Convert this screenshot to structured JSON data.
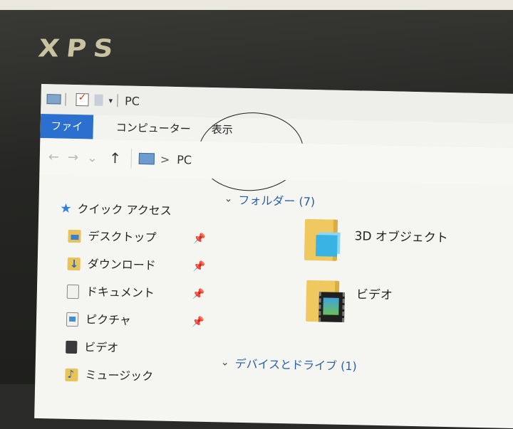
{
  "bezel": {
    "logo_text": "XPS"
  },
  "quick_access_toolbar": {
    "title": "PC",
    "dropdown_glyph": "▾"
  },
  "ribbon": {
    "tabs": [
      {
        "label": "ファイル",
        "active": true
      },
      {
        "label": "コンピューター",
        "active": false
      },
      {
        "label": "表示",
        "active": false
      }
    ],
    "accent_color": "#2b6fcf"
  },
  "address_bar": {
    "back_glyph": "←",
    "forward_glyph": "→",
    "recent_glyph": "⌄",
    "up_glyph": "↑",
    "separator_glyph": ">",
    "location": "PC"
  },
  "nav_pane": {
    "quick_access": {
      "label": "クイック アクセス",
      "icon": "star-icon"
    },
    "items": [
      {
        "label": "デスクトップ",
        "icon": "desktop-folder-icon",
        "pinned": true
      },
      {
        "label": "ダウンロード",
        "icon": "download-folder-icon",
        "pinned": true
      },
      {
        "label": "ドキュメント",
        "icon": "documents-icon",
        "pinned": true
      },
      {
        "label": "ピクチャ",
        "icon": "pictures-icon",
        "pinned": true
      },
      {
        "label": "ビデオ",
        "icon": "videos-icon",
        "pinned": false
      },
      {
        "label": "ミュージック",
        "icon": "music-icon",
        "pinned": false
      }
    ],
    "pin_glyph": "📌"
  },
  "content": {
    "folders_group": {
      "label": "フォルダー (7)"
    },
    "folder_items": [
      {
        "label": "3D オブジェクト",
        "icon": "3d-objects-folder-icon"
      },
      {
        "label": "ビデオ",
        "icon": "videos-folder-icon"
      }
    ],
    "devices_group": {
      "label": "デバイスとドライブ (1)"
    }
  }
}
